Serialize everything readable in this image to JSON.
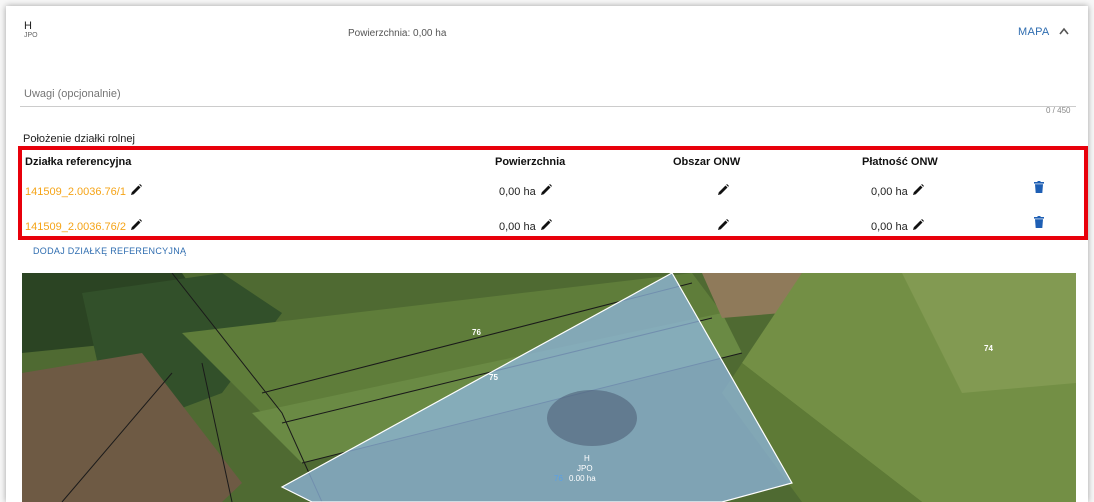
{
  "header": {
    "title": "H",
    "subtitle": "JPO",
    "area_text": "Powierzchnia: 0,00 ha",
    "map_button": "MAPA",
    "collapse_icon": "chevron-up-icon"
  },
  "notes": {
    "placeholder": "Uwagi (opcjonalnie)",
    "counter": "0 / 450"
  },
  "section": {
    "title": "Położenie działki rolnej"
  },
  "table": {
    "headers": [
      "Działka referencyjna",
      "Powierzchnia",
      "Obszar ONW",
      "Płatność ONW"
    ],
    "rows": [
      {
        "parcel": "141509_2.0036.76/1",
        "area": "0,00 ha",
        "onw_payment": "0,00 ha"
      },
      {
        "parcel": "141509_2.0036.76/2",
        "area": "0,00 ha",
        "onw_payment": "0,00 ha"
      }
    ],
    "edit_icon": "pencil-icon",
    "delete_icon": "trash-icon",
    "highlight_color": "#e8000b"
  },
  "add_parcel_link": "DODAJ DZIAŁKĘ REFERENCYJNĄ",
  "map": {
    "labels": {
      "parcel_76_top": "76",
      "parcel_75": "75",
      "parcel_74": "74",
      "parcel_76_bottom": "76",
      "selected_title": "H",
      "selected_jpo": "JPO",
      "selected_area": "0.00 ha"
    },
    "selection_color": "#8fb7e0"
  },
  "colors": {
    "accent": "#2f6db0",
    "link": "#f5a418"
  }
}
